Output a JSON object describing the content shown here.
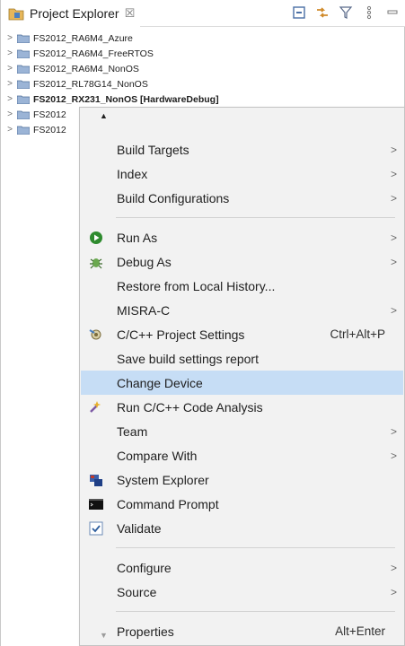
{
  "view": {
    "title": "Project Explorer",
    "close_glyph": "☒"
  },
  "toolbar": [
    "collapse-all-icon",
    "link-with-editor-icon",
    "filter-icon",
    "view-menu-icon",
    "minimize-icon"
  ],
  "tree": [
    {
      "label": "FS2012_RA6M4_Azure",
      "bold": false
    },
    {
      "label": "FS2012_RA6M4_FreeRTOS",
      "bold": false
    },
    {
      "label": "FS2012_RA6M4_NonOS",
      "bold": false
    },
    {
      "label": "FS2012_RL78G14_NonOS",
      "bold": false
    },
    {
      "label": "FS2012_RX231_NonOS [HardwareDebug]",
      "bold": true
    },
    {
      "label": "FS2012",
      "bold": false
    },
    {
      "label": "FS2012",
      "bold": false
    }
  ],
  "menu": {
    "items": [
      {
        "label": "Build Targets",
        "submenu": true
      },
      {
        "label": "Index",
        "submenu": true
      },
      {
        "label": "Build Configurations",
        "submenu": true
      },
      {
        "label": "Run As",
        "submenu": true,
        "icon": "run-icon"
      },
      {
        "label": "Debug As",
        "submenu": true,
        "icon": "debug-icon"
      },
      {
        "label": "Restore from Local History..."
      },
      {
        "label": "MISRA-C",
        "submenu": true
      },
      {
        "label": "C/C++ Project Settings",
        "accel": "Ctrl+Alt+P",
        "icon": "project-settings-icon"
      },
      {
        "label": "Save build settings report"
      },
      {
        "label": "Change Device",
        "selected": true
      },
      {
        "label": "Run C/C++ Code Analysis",
        "icon": "code-analysis-icon"
      },
      {
        "label": "Team",
        "submenu": true
      },
      {
        "label": "Compare With",
        "submenu": true
      },
      {
        "label": "System Explorer",
        "icon": "system-explorer-icon"
      },
      {
        "label": "Command Prompt",
        "icon": "command-prompt-icon"
      },
      {
        "label": "Validate",
        "icon": "validate-checkbox-icon"
      },
      {
        "label": "Configure",
        "submenu": true
      },
      {
        "label": "Source",
        "submenu": true
      },
      {
        "label": "Properties",
        "accel": "Alt+Enter"
      }
    ]
  },
  "colors": {
    "selection": "#c6ddf5",
    "menu_bg": "#f2f2f2",
    "run_green": "#2e8b2e"
  }
}
